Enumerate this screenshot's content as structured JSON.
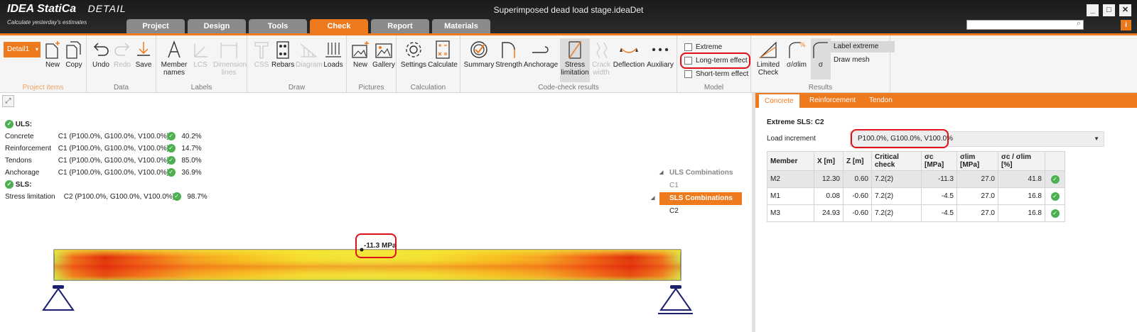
{
  "app": {
    "logo_brand": "IDEA StatiCa",
    "logo_product": "DETAIL",
    "tagline": "Calculate yesterday's estimates",
    "doc_title": "Superimposed dead load stage.ideaDet",
    "window_buttons": [
      "_",
      "□",
      "✕"
    ],
    "info_button": "i"
  },
  "tabs": [
    "Project",
    "Design",
    "Tools",
    "Check",
    "Report",
    "Materials"
  ],
  "active_tab": "Check",
  "ribbon": {
    "project_items": {
      "label": "Project items",
      "detail_dropdown": "Detail1",
      "new": "New",
      "copy": "Copy"
    },
    "data": {
      "label": "Data",
      "undo": "Undo",
      "redo": "Redo",
      "save": "Save"
    },
    "labels": {
      "label": "Labels",
      "member_names": "Member names",
      "lcs": "LCS",
      "dimension_lines": "Dimension lines"
    },
    "draw": {
      "label": "Draw",
      "css": "CSS",
      "rebars": "Rebars",
      "diagram": "Diagram",
      "loads": "Loads"
    },
    "pictures": {
      "label": "Pictures",
      "new": "New",
      "gallery": "Gallery"
    },
    "calculation": {
      "label": "Calculation",
      "settings": "Settings",
      "calculate": "Calculate"
    },
    "code_check": {
      "label": "Code-check results",
      "summary": "Summary",
      "strength": "Strength",
      "anchorage": "Anchorage",
      "stress_limitation": "Stress limitation",
      "crack_width": "Crack width",
      "deflection": "Deflection",
      "auxiliary": "Auxiliary"
    },
    "model": {
      "label": "Model",
      "extreme": "Extreme",
      "long_term": "Long-term effect",
      "short_term": "Short-term effect"
    },
    "results": {
      "label": "Results",
      "limited_check": "Limited Check",
      "sigma_lim": "σ/σlim",
      "sigma": "σ",
      "label_extreme": "Label extreme",
      "draw_mesh": "Draw mesh"
    }
  },
  "summary": {
    "uls_title": "ULS:",
    "uls_rows": [
      {
        "name": "Concrete",
        "combo": "C1 (P100.0%, G100.0%, V100.0%)",
        "value": "40.2%"
      },
      {
        "name": "Reinforcement",
        "combo": "C1 (P100.0%, G100.0%, V100.0%)",
        "value": "14.7%"
      },
      {
        "name": "Tendons",
        "combo": "C1 (P100.0%, G100.0%, V100.0%)",
        "value": "85.0%"
      },
      {
        "name": "Anchorage",
        "combo": "C1 (P100.0%, G100.0%, V100.0%)",
        "value": "36.9%"
      }
    ],
    "sls_title": "SLS:",
    "sls_rows": [
      {
        "name": "Stress limitation",
        "combo": "C2 (P100.0%, G100.0%, V100.0%)",
        "value": "98.7%"
      }
    ]
  },
  "tree": {
    "uls_combinations": "ULS Combinations",
    "c1": "C1",
    "sls_combinations": "SLS Combinations",
    "c2": "C2"
  },
  "beam": {
    "extreme_label": "-11.3 MPa"
  },
  "right_panel": {
    "tabs": [
      "Concrete",
      "Reinforcement",
      "Tendon"
    ],
    "extreme_title": "Extreme SLS: C2",
    "load_increment_label": "Load increment",
    "load_increment_value": "P100.0%, G100.0%, V100.0%",
    "table_headers": [
      "Member",
      "X [m]",
      "Z [m]",
      "Critical check",
      "σc [MPa]",
      "σlim [MPa]",
      "σc / σlim [%]"
    ],
    "table_rows": [
      [
        "M2",
        "12.30",
        "0.60",
        "7.2(2)",
        "-11.3",
        "27.0",
        "41.8"
      ],
      [
        "M1",
        "0.08",
        "-0.60",
        "7.2(2)",
        "-4.5",
        "27.0",
        "16.8"
      ],
      [
        "M3",
        "24.93",
        "-0.60",
        "7.2(2)",
        "-4.5",
        "27.0",
        "16.8"
      ]
    ]
  },
  "colors": {
    "accent": "#ee7a1e",
    "ok_green": "#4caf50",
    "highlight_red": "#e0101a"
  }
}
